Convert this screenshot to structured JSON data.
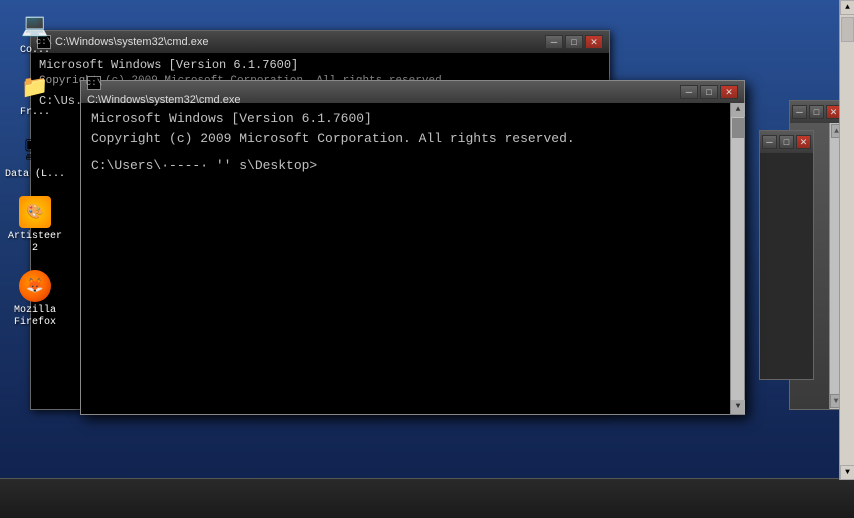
{
  "desktop": {
    "background_color": "#1e3c72"
  },
  "desktop_icons": [
    {
      "id": "computer",
      "label": "Co...",
      "icon": "💻"
    },
    {
      "id": "folder",
      "label": "Fr...",
      "icon": "📁"
    },
    {
      "id": "drive",
      "label": "Data (L...",
      "icon": "💾"
    },
    {
      "id": "artisteer",
      "label": "Artisteer 2",
      "icon": "🎨"
    },
    {
      "id": "firefox",
      "label": "Mozilla Firefox",
      "icon": "🦊"
    }
  ],
  "cmd_window_back": {
    "title": "C:\\Windows\\system32\\cmd.exe",
    "line1": "Microsoft Windows [Version 6.1.7600]",
    "line2": "Copyright (c) 2009 Microsoft Corporation.  All rights reserved.",
    "line3": "",
    "prompt": "C:\\Us..."
  },
  "cmd_window_front": {
    "title": "C:\\Windows\\system32\\cmd.exe",
    "line1": "Microsoft Windows [Version 6.1.7600]",
    "line2": "Copyright (c) 2009 Microsoft Corporation.  All rights reserved.",
    "line3": "",
    "prompt": "C:\\Users\\·----·  ''  s\\Desktop>"
  },
  "titlebar_buttons": {
    "minimize": "─",
    "maximize": "□",
    "close": "✕"
  },
  "scrollbar": {
    "arrow_up": "▲",
    "arrow_down": "▼"
  }
}
